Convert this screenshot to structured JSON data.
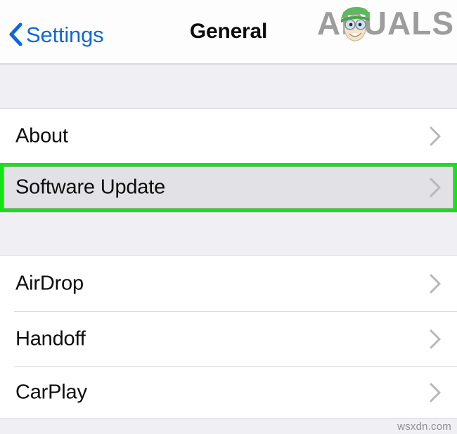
{
  "navbar": {
    "back_label": "Settings",
    "back_icon": "chevron-left-icon",
    "title": "General"
  },
  "brand": {
    "name": "APPUALS",
    "prefix": "A",
    "suffix": "PUALS",
    "mascot_icon": "cartoon-mascot-icon",
    "color": "#9d9d9d",
    "mascot_hair_color": "#5cba5c",
    "mascot_skin_color": "#f2ddc2"
  },
  "colors": {
    "accent_blue": "#1167d8",
    "highlight_green": "#14e414",
    "row_background": "#ffffff",
    "highlight_fill": "#e2e2e6",
    "group_background": "#efeff4",
    "separator": "#dcdce1",
    "chevron_gray": "#b6b6bb"
  },
  "sections": [
    {
      "id": "section-one",
      "rows": [
        {
          "id": "about",
          "label": "About",
          "chevron": "chevron-right-icon",
          "highlighted": false
        },
        {
          "id": "software-update",
          "label": "Software Update",
          "chevron": "chevron-right-icon",
          "highlighted": true
        }
      ]
    },
    {
      "id": "section-two",
      "rows": [
        {
          "id": "airdrop",
          "label": "AirDrop",
          "chevron": "chevron-right-icon",
          "highlighted": false
        },
        {
          "id": "handoff",
          "label": "Handoff",
          "chevron": "chevron-right-icon",
          "highlighted": false
        },
        {
          "id": "carplay",
          "label": "CarPlay",
          "chevron": "chevron-right-icon",
          "highlighted": false
        }
      ]
    }
  ],
  "footer": {
    "watermark": "wsxdn.com"
  }
}
